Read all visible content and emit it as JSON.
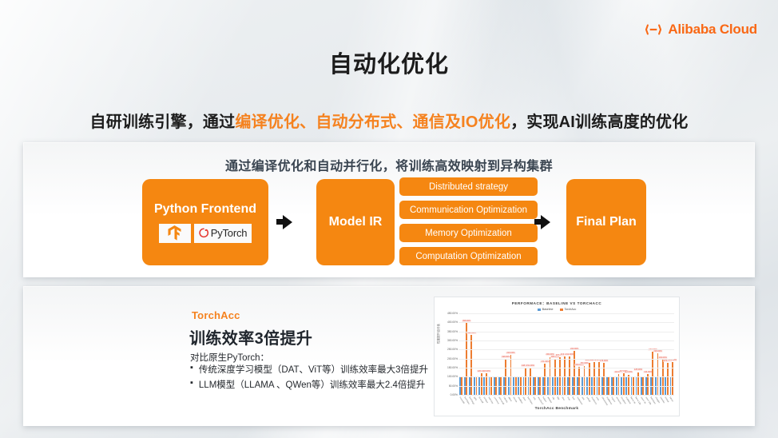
{
  "brand": {
    "name": "Alibaba Cloud",
    "logo_icon": "alibaba-cloud-logo-icon",
    "color": "#f96815"
  },
  "page": {
    "title": "自动化优化",
    "subtitle_parts": [
      {
        "text": "自研训练引擎，通过",
        "highlight": false
      },
      {
        "text": "编译优化、自动分布式、通信及IO优化",
        "highlight": true
      },
      {
        "text": "，实现AI训练高度的优化",
        "highlight": false
      }
    ],
    "accent_color": "#f5821f"
  },
  "diagram": {
    "heading": "通过编译优化和自动并行化，将训练高效映射到异构集群",
    "box_color": "#f58711",
    "python_frontend": {
      "label": "Python Frontend",
      "logos": [
        {
          "name": "tensorflow-logo-icon",
          "label": ""
        },
        {
          "name": "pytorch-logo-icon",
          "label": "PyTorch"
        }
      ]
    },
    "model_ir": {
      "label": "Model IR"
    },
    "optimizations": [
      "Distributed strategy",
      "Communication Optimization",
      "Memory Optimization",
      "Computation Optimization"
    ],
    "final_plan": {
      "label": "Final Plan"
    }
  },
  "torchacc": {
    "tag": "TorchAcc",
    "headline": "训练效率3倍提升",
    "intro": "对比原生PyTorch：",
    "bullets": [
      "传统深度学习模型（DAT、ViT等）训练效率最大3倍提升",
      "LLM模型（LLAMA 、QWen等）训练效率最大2.4倍提升"
    ],
    "bullet_marker": "▪"
  },
  "chart_data": {
    "type": "bar",
    "title": "PERFORMACE：BASELINE VS TORCHACC",
    "caption": "TorchAcc Benchmark",
    "xlabel": "TorchAcc Benchmark",
    "ylabel": "性能提升百分比",
    "ylim": [
      0,
      450
    ],
    "ytick_labels": [
      "0.00%",
      "50.00%",
      "100.00%",
      "150.00%",
      "200.00%",
      "250.00%",
      "300.00%",
      "350.00%",
      "400.00%",
      "450.00%"
    ],
    "ytick_values": [
      0,
      50,
      100,
      150,
      200,
      250,
      300,
      350,
      400,
      450
    ],
    "grid": true,
    "legend_position": "top",
    "series": [
      {
        "name": "Baseline",
        "color": "#5b9bd5",
        "values": [
          100,
          100,
          100,
          100,
          100,
          100,
          100,
          100,
          100,
          100,
          100,
          100,
          100,
          100,
          100,
          100,
          100,
          100,
          100,
          100,
          100,
          100,
          100,
          100,
          100,
          100,
          100,
          100,
          100,
          100,
          100,
          100,
          100,
          100,
          100,
          100,
          100,
          100,
          100,
          100,
          100,
          100,
          100,
          100
        ]
      },
      {
        "name": "TorchAcc",
        "color": "#ed7d31",
        "values": [
          100,
          398,
          332,
          100,
          120,
          118,
          100,
          100,
          100,
          198,
          219,
          100,
          100,
          148,
          151,
          100,
          100,
          171,
          209,
          196,
          207,
          213,
          212,
          243,
          153,
          161,
          178,
          180,
          179,
          176,
          100,
          100,
          113,
          117,
          112,
          100,
          125,
          100,
          114,
          237,
          229,
          193,
          175,
          182
        ]
      }
    ],
    "categories": [
      "resnet50",
      "bert-base",
      "bert-large",
      "gpt2",
      "t5-small",
      "vit-base",
      "swin-tiny",
      "convnext",
      "deit-small",
      "roberta",
      "albert",
      "electra",
      "distilbert",
      "xlnet",
      "bart-base",
      "mt5",
      "wav2vec2",
      "hubert",
      "whisper",
      "clip",
      "blip",
      "dino",
      "mae",
      "beit",
      "segformer",
      "detr",
      "yolov5",
      "maskrcnn",
      "unet",
      "efficientnet",
      "mobilenet",
      "regnet",
      "densenet",
      "inception",
      "mobilevit",
      "llama-7b",
      "llama-13b",
      "qwen-7b",
      "qwen-14b",
      "baichuan",
      "chatglm",
      "internlm",
      "mistral",
      "falcon"
    ],
    "data_labels": [
      "398.00%",
      "332.00%",
      "120.00%",
      "118.00%",
      "198.00%",
      "219.00%",
      "148.00%",
      "151.00%",
      "171.00%",
      "209.00%",
      "196.00%",
      "207.00%",
      "213.00%",
      "212.00%",
      "243.00%",
      "153.00%",
      "161.00%",
      "178.00%",
      "180.00%",
      "179.00%",
      "176.00%",
      "113.00%",
      "117.00%",
      "112.00%",
      "125.00%",
      "114.00%",
      "237.00%",
      "229.00%",
      "193.00%",
      "175.00%",
      "182.00%"
    ]
  }
}
